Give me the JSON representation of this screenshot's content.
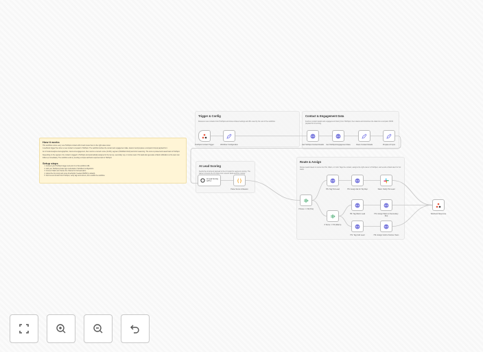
{
  "sticky": {
    "title": "How it works",
    "paragraphs": [
      "This workflow scores every new HubSpot contact with AI and routes them to the right sales owner.",
      "A webhook trigger fires when a new contact is created in HubSpot. The workflow fetches the contact and engagement data, cleans it and prepares a compact AI input payload for it.",
      "An AI model analyzes demographics, intent and engagement, then returns a numeric score (0-100), segment (Hot/Warm/Cold) and short reasoning. The score is parsed and saved back to HubSpot.",
      "Depending on the segment, the contact is tagged in HubSpot and automatically assigned to the top rep, secondary rep, or nurture team. Hot leads also generate a Slack notification so the team can follow up immediately. The workflow ends by sending a simple webhook response back to HubSpot."
    ],
    "setup_title": "Setup steps",
    "steps": [
      "Connect your HubSpot trigger and point it to this workflow URL.",
      "Add your HubSpot private app credentials in Workflow Configuration.",
      "Connect Slack and choose the channel for hot lead alerts.",
      "Adjust the AI prompt and score thresholds if needed (80/50 by default).",
      "Send a test contact from HubSpot, verify tags and owners, then enable the workflow."
    ]
  },
  "groups": [
    {
      "id": "g1",
      "title": "Trigger & Config",
      "desc": "Receives new contacts from HubSpot and stores shared settings and IDs used by the rest of the workflow."
    },
    {
      "id": "g2",
      "title": "Contact & Engagement Data",
      "desc": "Fetches contact details and engagement history from HubSpot, then cleans and structures the data into a compact JSON payload for AI scoring."
    },
    {
      "id": "g3",
      "title": "AI Lead Scoring",
      "desc": "Sends the structured payload to the AI model for segment scoring. The parser converts the AI output into numeric fields and the routing."
    },
    {
      "id": "g4",
      "title": "Route & Assign",
      "desc": "Routes leads based on score into Hot, Warm, or Cold. Tags the contact, assigns the right owner in HubSpot, and sends a Slack alert for hot leads."
    }
  ],
  "nodes": [
    {
      "id": "trigger",
      "label": "HubSpot Contact Trigger",
      "icon": "hubspot-icon"
    },
    {
      "id": "config",
      "label": "Workflow Configuration",
      "icon": "pencil-icon"
    },
    {
      "id": "getContact",
      "label": "Get HubSpot Contact Details",
      "icon": "globe-icon"
    },
    {
      "id": "getEng",
      "label": "Get HubSpot Engagement Data",
      "icon": "globe-icon"
    },
    {
      "id": "clean",
      "label": "Clean Contact Details",
      "icon": "pencil-icon"
    },
    {
      "id": "prep",
      "label": "Prepare AI Input",
      "icon": "pencil-icon"
    },
    {
      "id": "ai",
      "label": "AI Lead Scoring GPT-4",
      "icon": "openai-icon"
    },
    {
      "id": "parse",
      "label": "Parse Score & Reason",
      "icon": "code-icon"
    },
    {
      "id": "ifHot",
      "label": "If Score >= 80 (Hot)",
      "icon": "if-icon"
    },
    {
      "id": "ifWarm",
      "label": "If Score >= 50 (Warm)",
      "icon": "if-icon"
    },
    {
      "id": "tagHot",
      "label": "HS: Tag Hot Lead",
      "icon": "globe-icon"
    },
    {
      "id": "assignHot",
      "label": "HS: Assign AE for Top Rep",
      "icon": "globe-icon"
    },
    {
      "id": "slack",
      "label": "Slack: Notify Hot Lead",
      "icon": "slack-icon"
    },
    {
      "id": "tagWarm",
      "label": "HS: Tag Warm Lead",
      "icon": "globe-icon"
    },
    {
      "id": "assignWarm",
      "label": "HS: Assign Warm to Secondary Rep",
      "icon": "globe-icon"
    },
    {
      "id": "tagCold",
      "label": "HS: Tag Cold Lead",
      "icon": "globe-icon"
    },
    {
      "id": "assignCold",
      "label": "HS: Assign Cold to Nurture Team",
      "icon": "globe-icon"
    },
    {
      "id": "respond",
      "label": "Webhook Response",
      "icon": "hubspot-icon"
    }
  ],
  "connections": [
    [
      "trigger",
      "config"
    ],
    [
      "config",
      "getContact"
    ],
    [
      "getContact",
      "getEng"
    ],
    [
      "getEng",
      "clean"
    ],
    [
      "clean",
      "prep"
    ],
    [
      "prep",
      "ai"
    ],
    [
      "ai",
      "parse"
    ],
    [
      "parse",
      "ifHot"
    ],
    [
      "ifHot",
      "tagHot"
    ],
    [
      "ifHot",
      "ifWarm"
    ],
    [
      "tagHot",
      "assignHot"
    ],
    [
      "assignHot",
      "slack"
    ],
    [
      "ifWarm",
      "tagWarm"
    ],
    [
      "ifWarm",
      "tagCold"
    ],
    [
      "tagWarm",
      "assignWarm"
    ],
    [
      "tagCold",
      "assignCold"
    ],
    [
      "slack",
      "respond"
    ],
    [
      "assignWarm",
      "respond"
    ],
    [
      "assignCold",
      "respond"
    ]
  ],
  "controls": [
    {
      "id": "fit",
      "icon": "fit-view-icon"
    },
    {
      "id": "zoom-in",
      "icon": "zoom-in-icon"
    },
    {
      "id": "zoom-out",
      "icon": "zoom-out-icon"
    },
    {
      "id": "undo",
      "icon": "undo-icon"
    }
  ],
  "colors": {
    "hubspot": "#e8563c",
    "edge": "#c4c4c4",
    "globe": "#5b5bd6",
    "pencil": "#7b7be8",
    "if": "#3fa66a",
    "code": "#f0a020"
  }
}
